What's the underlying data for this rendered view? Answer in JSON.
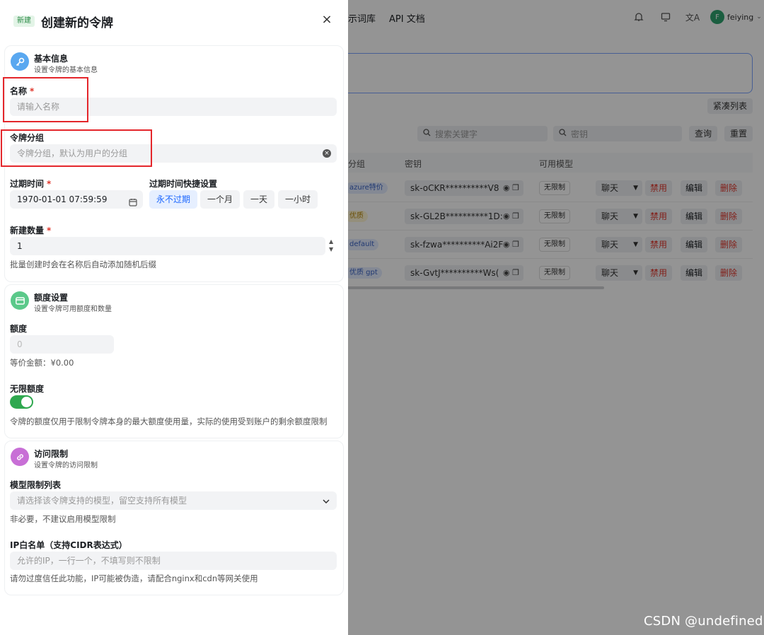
{
  "background_app": {
    "nav": [
      "示词库",
      "API 文档"
    ],
    "username": "feiying",
    "avatar_letter": "F",
    "compact_list": "紧凑列表",
    "search_placeholder": "搜索关键字",
    "key_search_placeholder": "密钥",
    "query_btn": "查询",
    "reset_btn": "重置",
    "columns": [
      "分组",
      "密钥",
      "可用模型"
    ],
    "rows": [
      {
        "group": "azure特价",
        "key": "sk-oCKR**********V8",
        "models": "无限制",
        "chat": "聊天",
        "disable": "禁用",
        "edit": "编辑",
        "delete": "删除"
      },
      {
        "group": "优质",
        "key": "sk-GL2B**********1D:",
        "models": "无限制",
        "chat": "聊天",
        "disable": "禁用",
        "edit": "编辑",
        "delete": "删除"
      },
      {
        "group": "default",
        "key": "sk-fzwa**********Ai2F",
        "models": "无限制",
        "chat": "聊天",
        "disable": "禁用",
        "edit": "编辑",
        "delete": "删除"
      },
      {
        "group": "优质 gpt",
        "key": "sk-GvtJ**********Ws(",
        "models": "无限制",
        "chat": "聊天",
        "disable": "禁用",
        "edit": "编辑",
        "delete": "删除"
      }
    ]
  },
  "sheet": {
    "badge": "新建",
    "title": "创建新的令牌",
    "close": "×",
    "basic": {
      "title": "基本信息",
      "subtitle": "设置令牌的基本信息",
      "name_label": "名称",
      "name_placeholder": "请输入名称",
      "group_label": "令牌分组",
      "group_placeholder": "令牌分组，默认为用户的分组",
      "expire_label": "过期时间",
      "expire_value": "1970-01-01 07:59:59",
      "quick_label": "过期时间快捷设置",
      "quick_options": [
        "永不过期",
        "一个月",
        "一天",
        "一小时"
      ],
      "count_label": "新建数量",
      "count_value": "1",
      "count_hint": "批量创建时会在名称后自动添加随机后缀"
    },
    "quota": {
      "title": "额度设置",
      "subtitle": "设置令牌可用额度和数量",
      "quota_label": "额度",
      "quota_placeholder": "0",
      "equiv": "等价金额：¥0.00",
      "unlimited_label": "无限额度",
      "unlimited_on": true,
      "unlimited_hint": "令牌的额度仅用于限制令牌本身的最大额度使用量，实际的使用受到账户的剩余额度限制"
    },
    "access": {
      "title": "访问限制",
      "subtitle": "设置令牌的访问限制",
      "models_label": "模型限制列表",
      "models_placeholder": "请选择该令牌支持的模型，留空支持所有模型",
      "models_hint": "非必要，不建议启用模型限制",
      "ip_label": "IP白名单（支持CIDR表达式）",
      "ip_placeholder": "允许的IP，一行一个，不填写则不限制",
      "ip_hint": "请勿过度信任此功能，IP可能被伪造，请配合nginx和cdn等网关使用"
    }
  },
  "watermark": "CSDN @undefined",
  "colors": {
    "accent": "#1a66ff",
    "toggle_on": "#2fa84f",
    "danger": "#e0362b",
    "annotation": "#e4262b"
  }
}
